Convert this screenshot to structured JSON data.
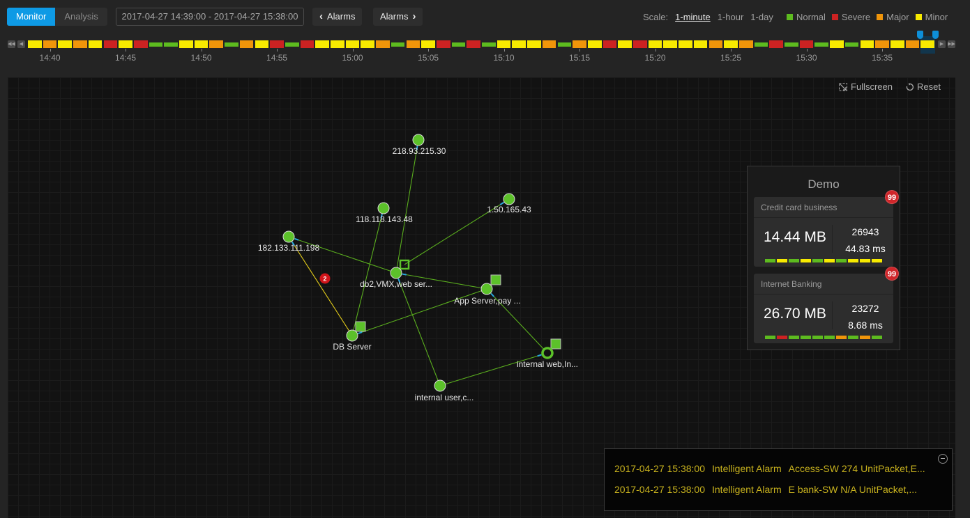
{
  "header": {
    "mode_tabs": [
      {
        "label": "Monitor",
        "active": true
      },
      {
        "label": "Analysis",
        "active": false
      }
    ],
    "time_range": "2017-04-27 14:39:00 - 2017-04-27 15:38:00",
    "prev_alarms_label": "Alarms",
    "next_alarms_label": "Alarms",
    "scale_label": "Scale:",
    "scale_options": [
      {
        "label": "1-minute",
        "selected": true
      },
      {
        "label": "1-hour",
        "selected": false
      },
      {
        "label": "1-day",
        "selected": false
      }
    ],
    "legend": [
      {
        "label": "Normal",
        "color": "#5dbb1f"
      },
      {
        "label": "Severe",
        "color": "#cc2222"
      },
      {
        "label": "Major",
        "color": "#f0950a"
      },
      {
        "label": "Minor",
        "color": "#f7ea00"
      }
    ]
  },
  "status_colors": {
    "G": "#5dbb1f",
    "R": "#cc2222",
    "O": "#f0950a",
    "Y": "#f7ea00"
  },
  "timeline": {
    "start": "14:39",
    "end": "15:38",
    "segments": "YOYOYRYRGGYYOGOYRGRYYYYOGOYRGRGYYYOGOYRYRYYYYOYOGRGRGYGYOYOY",
    "selected_index": 59,
    "ticks": [
      "14:40",
      "14:45",
      "14:50",
      "14:55",
      "15:00",
      "15:05",
      "15:10",
      "15:15",
      "15:20",
      "15:25",
      "15:30",
      "15:35"
    ]
  },
  "canvas": {
    "fullscreen_label": "Fullscreen",
    "reset_label": "Reset"
  },
  "graph": {
    "nodes": [
      {
        "id": "n218",
        "label": "218.93.215.30",
        "shape": "circle"
      },
      {
        "id": "n118",
        "label": "118.118.143.48",
        "shape": "circle"
      },
      {
        "id": "n150",
        "label": "1.50.165.43",
        "shape": "circle"
      },
      {
        "id": "n182",
        "label": "182.133.111.198",
        "shape": "circle"
      },
      {
        "id": "db2",
        "label": "db2,VMX,web ser...",
        "shape": "circle",
        "marker": "hollow-square"
      },
      {
        "id": "app",
        "label": "App Server,pay ...",
        "shape": "circle",
        "marker": "square"
      },
      {
        "id": "dbs",
        "label": "DB Server",
        "shape": "circle",
        "marker": "square"
      },
      {
        "id": "iweb",
        "label": "internal web,In...",
        "shape": "ring",
        "marker": "square"
      },
      {
        "id": "iuser",
        "label": "internal user,c...",
        "shape": "circle"
      }
    ],
    "edges": [
      {
        "from": "n218",
        "to": "db2",
        "status": "normal"
      },
      {
        "from": "n118",
        "to": "dbs",
        "status": "normal"
      },
      {
        "from": "n150",
        "to": "db2",
        "status": "normal"
      },
      {
        "from": "n182",
        "to": "db2",
        "status": "normal"
      },
      {
        "from": "n182",
        "to": "dbs",
        "status": "minor",
        "alarm_count": "2"
      },
      {
        "from": "db2",
        "to": "app",
        "status": "normal"
      },
      {
        "from": "dbs",
        "to": "app",
        "status": "normal"
      },
      {
        "from": "db2",
        "to": "iuser",
        "status": "normal"
      },
      {
        "from": "app",
        "to": "iweb",
        "status": "normal"
      },
      {
        "from": "iweb",
        "to": "iuser",
        "status": "normal"
      }
    ]
  },
  "demo_panel": {
    "title": "Demo",
    "cards": [
      {
        "name": "Credit card business",
        "badge": "99",
        "traffic": "14.44 MB",
        "count": "26943",
        "latency": "44.83 ms",
        "bars": "GYGYGYGYYY"
      },
      {
        "name": "Internet Banking",
        "badge": "99",
        "traffic": "26.70 MB",
        "count": "23272",
        "latency": "8.68 ms",
        "bars": "GRGGGGOGOG"
      }
    ]
  },
  "alarms": [
    {
      "time": "2017-04-27 15:38:00",
      "type": "Intelligent Alarm",
      "message": "Access-SW 274 UnitPacket,E..."
    },
    {
      "time": "2017-04-27 15:38:00",
      "type": "Intelligent Alarm",
      "message": "E bank-SW N/A UnitPacket,..."
    }
  ]
}
